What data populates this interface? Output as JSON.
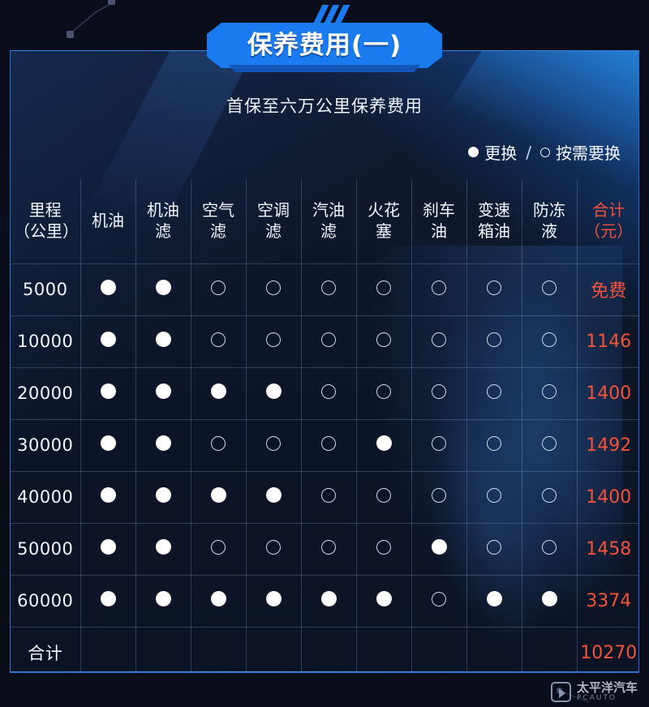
{
  "banner": {
    "title": "保养费用(一)",
    "stripes": 3
  },
  "subtitle": "首保至六万公里保养费用",
  "legend": {
    "full_label": "更换",
    "separator": "/",
    "open_label": "按需要换",
    "full_icon": "filled-circle-icon",
    "open_icon": "hollow-circle-icon"
  },
  "colors": {
    "accent_blue": "#1a7bf0",
    "panel_border": "#2b6fd0",
    "total_red": "#f2533a",
    "text": "#f3f7fe",
    "background": "#0a0e1a"
  },
  "table": {
    "headers": [
      "里程\n（公里）",
      "机油",
      "机油\n滤",
      "空气\n滤",
      "空调\n滤",
      "汽油\n滤",
      "火花\n塞",
      "刹车\n油",
      "变速\n箱油",
      "防冻\n液",
      "合计\n（元）"
    ],
    "rows": [
      {
        "km": "5000",
        "marks": [
          "full",
          "full",
          "open",
          "open",
          "open",
          "open",
          "open",
          "open",
          "open"
        ],
        "total": "免费"
      },
      {
        "km": "10000",
        "marks": [
          "full",
          "full",
          "open",
          "open",
          "open",
          "open",
          "open",
          "open",
          "open"
        ],
        "total": "1146"
      },
      {
        "km": "20000",
        "marks": [
          "full",
          "full",
          "full",
          "full",
          "open",
          "open",
          "open",
          "open",
          "open"
        ],
        "total": "1400"
      },
      {
        "km": "30000",
        "marks": [
          "full",
          "full",
          "open",
          "open",
          "open",
          "full",
          "open",
          "open",
          "open"
        ],
        "total": "1492"
      },
      {
        "km": "40000",
        "marks": [
          "full",
          "full",
          "full",
          "full",
          "open",
          "open",
          "open",
          "open",
          "open"
        ],
        "total": "1400"
      },
      {
        "km": "50000",
        "marks": [
          "full",
          "full",
          "open",
          "open",
          "open",
          "open",
          "full",
          "open",
          "open"
        ],
        "total": "1458"
      },
      {
        "km": "60000",
        "marks": [
          "full",
          "full",
          "full",
          "full",
          "full",
          "full",
          "open",
          "full",
          "full"
        ],
        "total": "3374"
      }
    ],
    "summary": {
      "label": "合计",
      "total": "10270"
    }
  },
  "watermark": {
    "cn": "太平洋汽车",
    "en": "PCAUTO",
    "logo": "play-button-logo"
  }
}
